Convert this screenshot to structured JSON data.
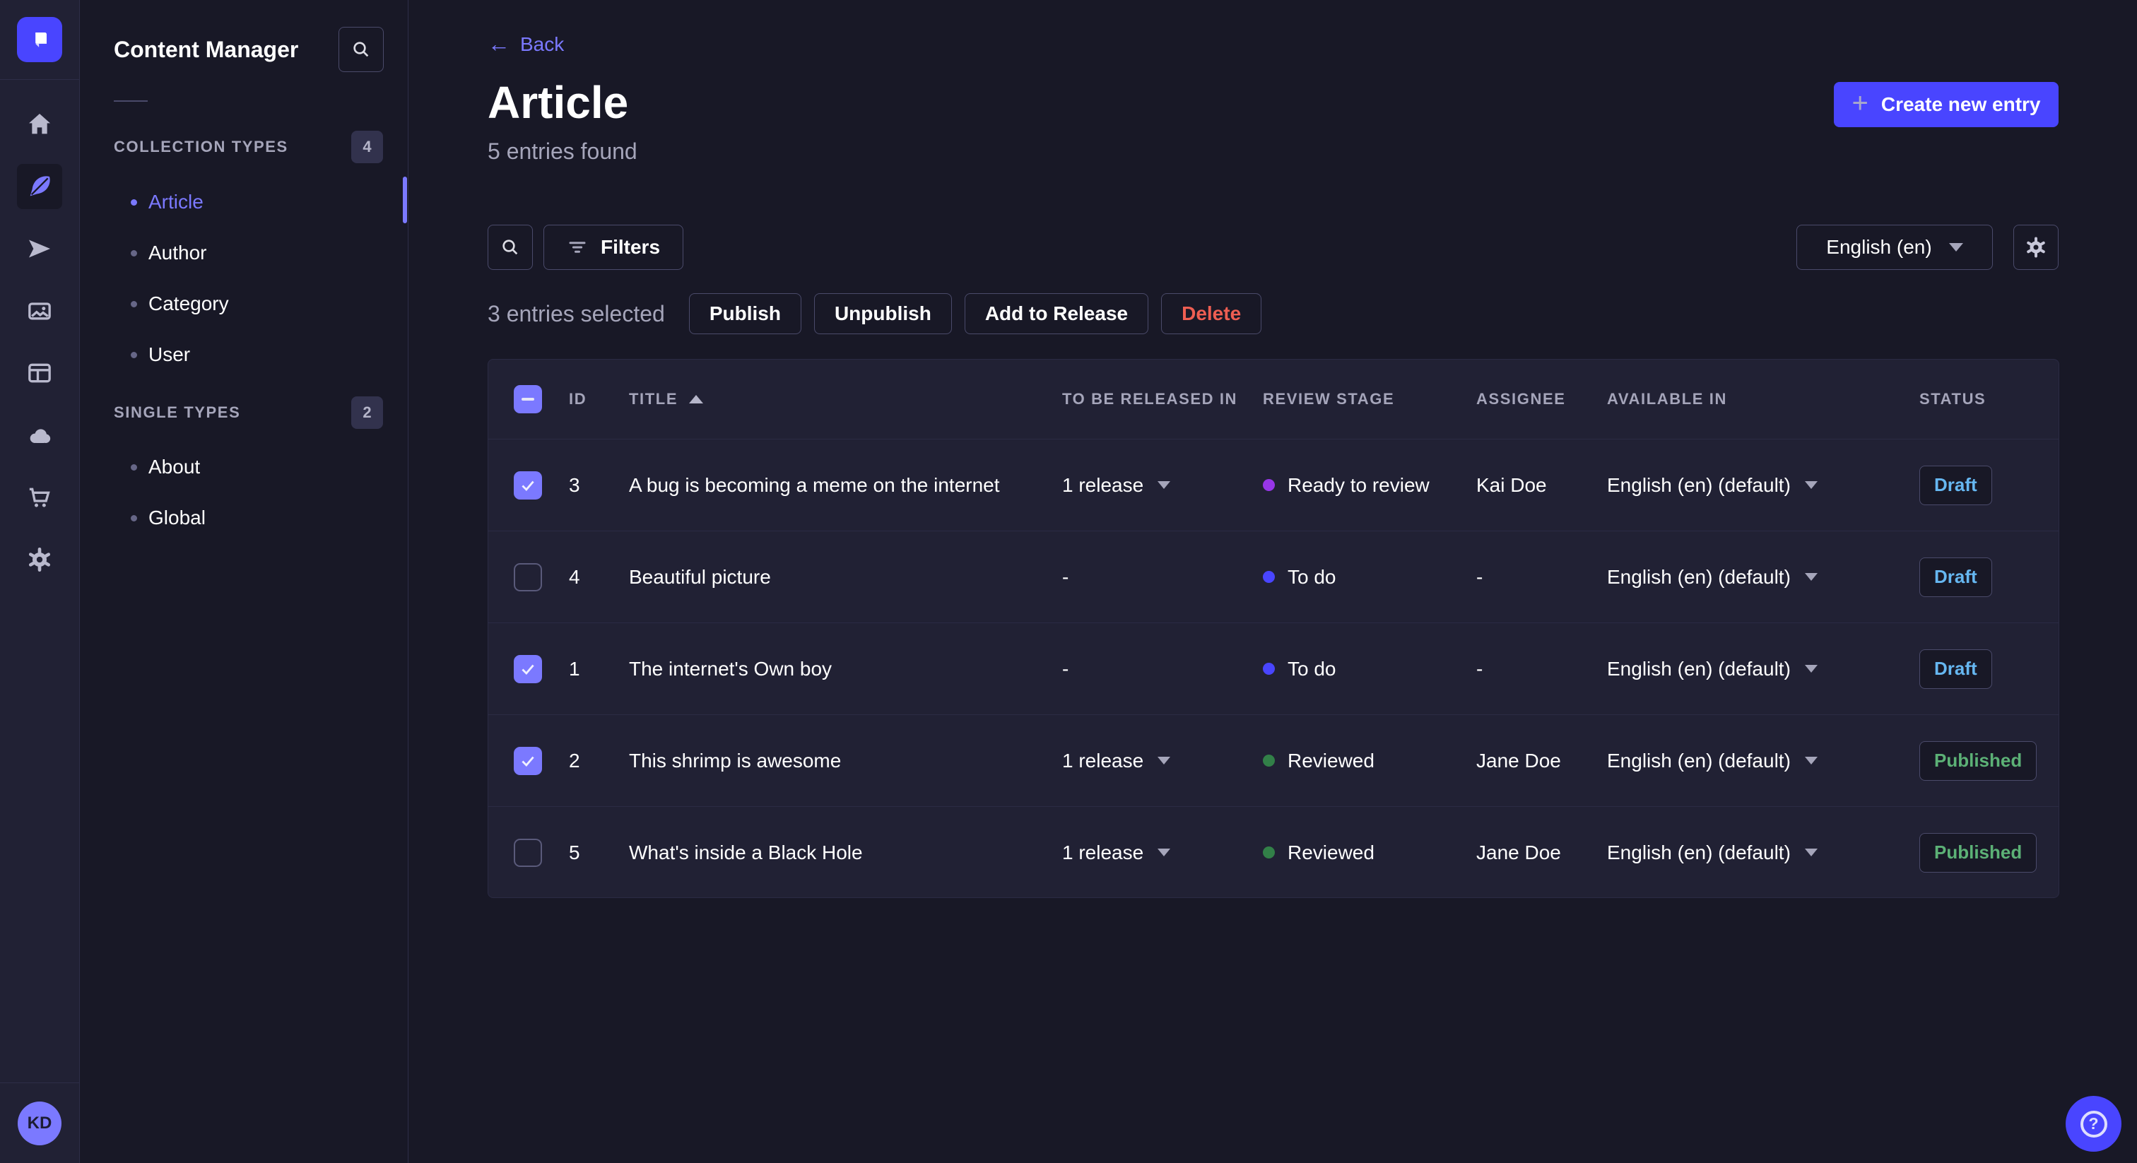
{
  "nav": {
    "items": [
      {
        "name": "home"
      },
      {
        "name": "content-manager",
        "active": true
      },
      {
        "name": "releases"
      },
      {
        "name": "media-library"
      },
      {
        "name": "content-type-builder"
      },
      {
        "name": "deploy"
      },
      {
        "name": "marketplace"
      },
      {
        "name": "settings"
      }
    ],
    "avatar_initials": "KD"
  },
  "sidebar": {
    "title": "Content Manager",
    "sections": [
      {
        "label": "COLLECTION TYPES",
        "count": "4",
        "items": [
          {
            "label": "Article",
            "active": true
          },
          {
            "label": "Author"
          },
          {
            "label": "Category"
          },
          {
            "label": "User"
          }
        ]
      },
      {
        "label": "SINGLE TYPES",
        "count": "2",
        "items": [
          {
            "label": "About"
          },
          {
            "label": "Global"
          }
        ]
      }
    ]
  },
  "header": {
    "back_label": "Back",
    "title": "Article",
    "subtitle": "5 entries found",
    "create_label": "Create new entry"
  },
  "toolbar": {
    "filters_label": "Filters",
    "locale": "English (en)",
    "selected_text": "3 entries selected",
    "actions": [
      "Publish",
      "Unpublish",
      "Add to Release",
      "Delete"
    ]
  },
  "table": {
    "columns": [
      "ID",
      "TITLE",
      "TO BE RELEASED IN",
      "REVIEW STAGE",
      "ASSIGNEE",
      "AVAILABLE IN",
      "STATUS"
    ],
    "sorted_by": "TITLE",
    "sort_direction": "asc",
    "rows": [
      {
        "selected": true,
        "id": "3",
        "title": "A bug is becoming a meme on the internet",
        "release": "1 release",
        "stage": "Ready to review",
        "stage_color": "#9736e8",
        "assignee": "Kai Doe",
        "locale": "English (en) (default)",
        "status": "Draft"
      },
      {
        "selected": false,
        "id": "4",
        "title": "Beautiful picture",
        "release": "-",
        "stage": "To do",
        "stage_color": "#4945ff",
        "assignee": "-",
        "locale": "English (en) (default)",
        "status": "Draft"
      },
      {
        "selected": true,
        "id": "1",
        "title": "The internet's Own boy",
        "release": "-",
        "stage": "To do",
        "stage_color": "#4945ff",
        "assignee": "-",
        "locale": "English (en) (default)",
        "status": "Draft"
      },
      {
        "selected": true,
        "id": "2",
        "title": "This shrimp is awesome",
        "release": "1 release",
        "stage": "Reviewed",
        "stage_color": "#328048",
        "assignee": "Jane Doe",
        "locale": "English (en) (default)",
        "status": "Published"
      },
      {
        "selected": false,
        "id": "5",
        "title": "What's inside a Black Hole",
        "release": "1 release",
        "stage": "Reviewed",
        "stage_color": "#328048",
        "assignee": "Jane Doe",
        "locale": "English (en) (default)",
        "status": "Published"
      }
    ]
  },
  "icons": {
    "back_arrow": "←",
    "plus": "+",
    "help": "?"
  },
  "colors": {
    "primary": "#4945ff",
    "primary_light": "#7b79ff",
    "draft": "#66b7f1",
    "published": "#5cb176",
    "danger": "#ee5e52",
    "stage_todo": "#4945ff",
    "stage_ready_to_review": "#9736e8",
    "stage_reviewed": "#328048"
  }
}
